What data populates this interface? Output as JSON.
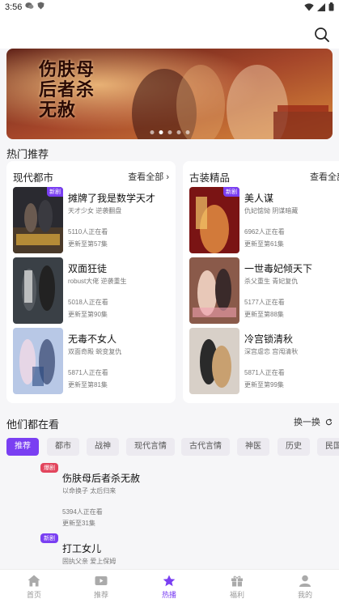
{
  "status_bar": {
    "time": "3:56"
  },
  "banner": {
    "title": "伤肤母后者杀无赦",
    "dots": 5,
    "active_dot": 1
  },
  "hot": {
    "title": "热门推荐",
    "modern": {
      "name": "现代都市",
      "more": "查看全部",
      "items": [
        {
          "title": "摊牌了我是数学天才",
          "tags": "天才少女 逆袭翻盘",
          "watch": "5110人正在看",
          "ep": "更新至第57集",
          "badge": "新剧"
        },
        {
          "title": "双面狂徒",
          "tags": "robust大佬 逆袭重生",
          "watch": "5018人正在看",
          "ep": "更新至第90集",
          "badge": ""
        },
        {
          "title": "无毒不女人",
          "tags": "双面奇殿 蜕变复仇",
          "watch": "5871人正在看",
          "ep": "更新至第81集",
          "badge": ""
        }
      ]
    },
    "ancient": {
      "name": "古装精品",
      "more": "查看全部",
      "items": [
        {
          "title": "美人谋",
          "tags": "仇妃惦恸 阴谋暗藏",
          "watch": "6962人正在看",
          "ep": "更新至第61集",
          "badge": "新剧"
        },
        {
          "title": "一世毒妃倾天下",
          "tags": "杀父重生 青妃复仇",
          "watch": "5177人正在看",
          "ep": "更新至第88集",
          "badge": ""
        },
        {
          "title": "冷宫锁清秋",
          "tags": "深宫虐恋 宫闱清秋",
          "watch": "5871人正在看",
          "ep": "更新至第99集",
          "badge": ""
        }
      ]
    }
  },
  "watching": {
    "title": "他们都在看",
    "refresh": "换一换",
    "chips": [
      "推荐",
      "都市",
      "战神",
      "现代言情",
      "古代言情",
      "神医",
      "历史",
      "民国"
    ],
    "items": [
      {
        "badge": "爆剧",
        "badge_color": "#e2455d",
        "title": "伤肤母后者杀无赦",
        "tags": "以命换子 太后归来",
        "watch": "5394人正在看",
        "ep": "更新至31集"
      },
      {
        "badge": "新剧",
        "badge_color": "#7a3ff2",
        "title": "打工女儿",
        "tags": "固执父亲 爱上保姆",
        "watch": "",
        "ep": ""
      }
    ]
  },
  "tabs": [
    {
      "label": "首页",
      "icon": "home-icon"
    },
    {
      "label": "推荐",
      "icon": "video-icon"
    },
    {
      "label": "热播",
      "icon": "star-icon",
      "active": true
    },
    {
      "label": "福利",
      "icon": "gift-icon"
    },
    {
      "label": "我的",
      "icon": "user-icon"
    }
  ],
  "colors": {
    "accent": "#7a3ff2",
    "badge_red": "#e2455d"
  }
}
